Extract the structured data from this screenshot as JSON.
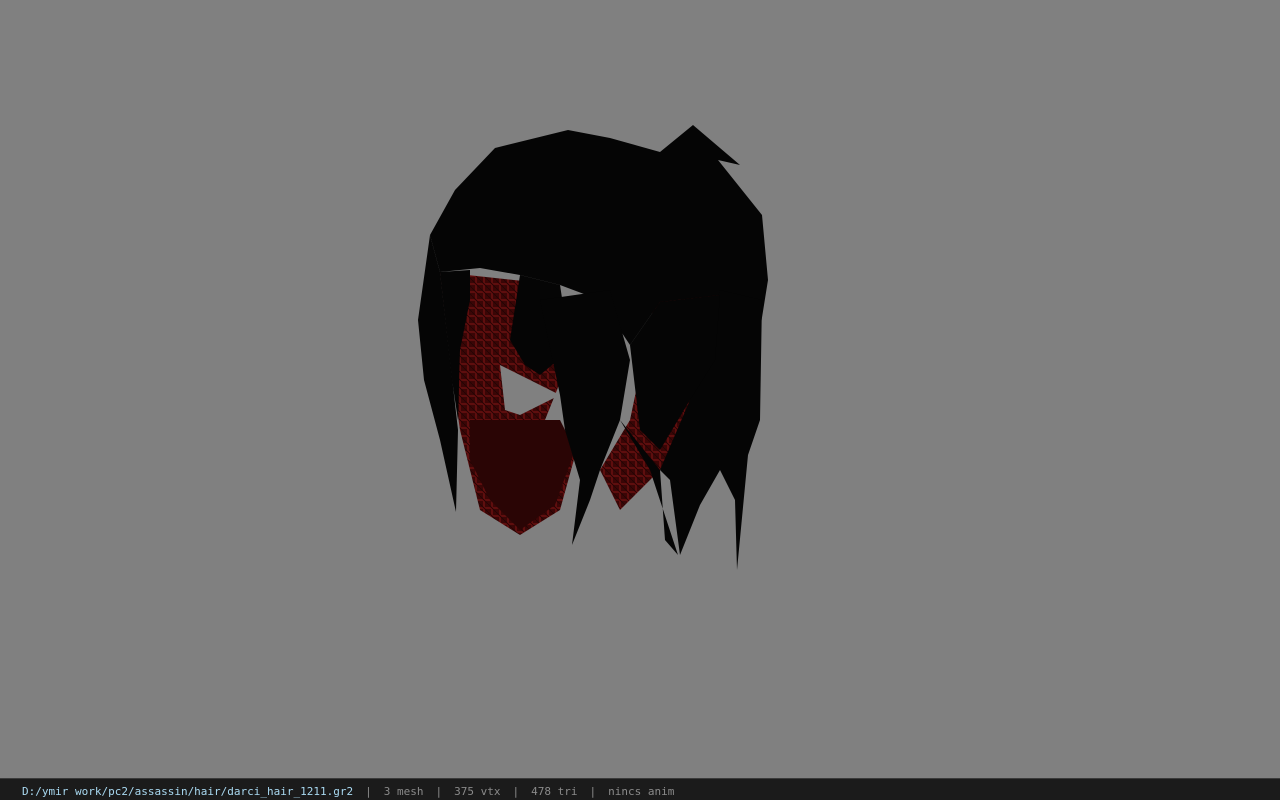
{
  "viewer": {
    "background_color": "#808080",
    "model": {
      "hair_color": "#050505",
      "face_color": "#3a0808",
      "highlight_color": "#4a0a0a"
    }
  },
  "statusbar": {
    "file_path": "D:/ymir work/pc2/assassin/hair/darci_hair_1211.gr2",
    "separator": "|",
    "mesh_count": "3 mesh",
    "vertex_count": "375 vtx",
    "triangle_count": "478 tri",
    "anim_status": "nincs anim"
  }
}
